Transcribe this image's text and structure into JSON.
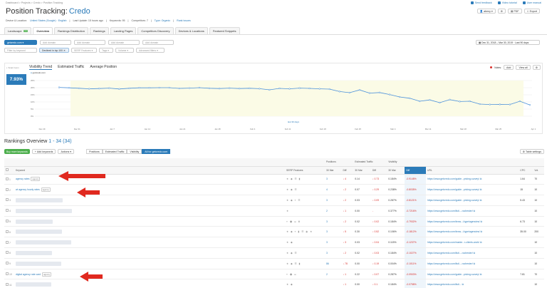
{
  "breadcrumb": [
    "Dashboard",
    "Projects",
    "Credo",
    "Position Tracking"
  ],
  "top_links": [
    "Send feedback",
    "Video tutorial",
    "User manual"
  ],
  "page": {
    "title": "Position Tracking:",
    "project": "Credo"
  },
  "header_actions": {
    "user": "abeny",
    "pdf": "PDF",
    "export": "Export"
  },
  "meta": {
    "device_label": "Device & Location:",
    "device_value": "United States (Google) · English",
    "last_update": "Last Update: 15 hours ago",
    "keywords": "Keywords: 95",
    "competitors": "Competitors: 7",
    "type": "Type: Organic",
    "rank_issues": "Rank issues"
  },
  "tabs": [
    {
      "label": "Landscape",
      "badge": "new"
    },
    {
      "label": "Overview",
      "active": true
    },
    {
      "label": "Rankings Distribution"
    },
    {
      "label": "Rankings"
    },
    {
      "label": "Landing Pages"
    },
    {
      "label": "Competitors Discovery"
    },
    {
      "label": "Devices & Locations"
    },
    {
      "label": "Featured Snippets"
    }
  ],
  "filters": {
    "domain": "getcredo.com",
    "add_domain": "Add domain",
    "search_placeholder": "Filter by keyword",
    "declined": "Declined in top 100",
    "serp": "SERP Features",
    "tags": "Tags",
    "volume": "Volume",
    "advanced": "Advanced filters",
    "date_range": "Dec 31, 2018 – Mar 30, 2019 · Last 90 days"
  },
  "chart_tabs": [
    "Visibility Trend",
    "Estimated Traffic",
    "Average Position"
  ],
  "chart": {
    "smart_zoom": "Smart zoom",
    "visibility_value": "7.93%",
    "legend_domain": "getcredo.com",
    "notes_label": "Notes:",
    "add_btn": "Add",
    "view_all": "View all",
    "last30": "last 30 days"
  },
  "chart_data": {
    "type": "line",
    "x_ticks": [
      "Dec 29",
      "Dec 31",
      "Jan 7",
      "Jan 14",
      "Jan 21",
      "Jan 28",
      "Feb 4",
      "Feb 11",
      "Feb 18",
      "Feb 25",
      "Mar 4",
      "Mar 11",
      "Mar 18",
      "Mar 25",
      "Apr 1"
    ],
    "y_ticks": [
      "25%",
      "20%",
      "15%",
      "10%",
      "5%",
      "0%"
    ],
    "ylim": [
      0,
      25
    ],
    "series": [
      {
        "name": "getcredo.com",
        "values": [
          20.2,
          19.9,
          19.6,
          19.2,
          19.4,
          19.7,
          19.1,
          19.6,
          19.9,
          19.9,
          20,
          20,
          19.5,
          19.7,
          20,
          19.6,
          19.4,
          19.7,
          19.4,
          19.6,
          19.3,
          18.5,
          19.5,
          19.2,
          19.7,
          19.5,
          19.2,
          19,
          17.3,
          16.5,
          18.4,
          16.2,
          16.6,
          15.2,
          13.5,
          12.6,
          10.5,
          11.4,
          9.5,
          11.6,
          10.3,
          10.5,
          8.5,
          8.2,
          8.3,
          8.2,
          10.5,
          7.9
        ],
        "x_start": "Dec 31"
      }
    ]
  },
  "rankings": {
    "title": "Rankings Overview",
    "range": "1 - 34 (34)",
    "buy_btn": "Buy more keywords",
    "add_keywords": "Add keywords",
    "actions": "Actions",
    "view_btns": [
      "Positions",
      "Estimated Traffic",
      "Visibility",
      "All for getcredo.com"
    ],
    "table_settings": "Table settings",
    "headers": {
      "keyword": "Keyword",
      "serp": "SERP Features",
      "positions": "Positions",
      "traffic": "Estimated Traffic",
      "visibility": "Visibility",
      "date": "30 Mar",
      "diff": "Diff",
      "url": "URL",
      "cpc": "CPC",
      "vol": "Vol."
    },
    "rows": [
      {
        "n": "1",
        "kw": "agency rates",
        "tag": "agency",
        "serp": "★ ◆ ☰ ▮",
        "pos": "3",
        "pdiff": "↓ 4",
        "tr": "0.14",
        "tdiff": "↓ 0.73",
        "vis": "0.184%",
        "vdiff": "-0.9148%",
        "url": "https://www.getcredo.com/guide...pricing-survey/",
        "cpc": "1.64",
        "vol": "70"
      },
      {
        "n": "2",
        "kw": "wi agency hourly rates",
        "tag": "agency",
        "serp": "★ ◆ ☰",
        "pos": "4",
        "pdiff": "↓ 2",
        "tr": "0.07",
        "tdiff": "↓ 0.29",
        "vis": "0.238%",
        "vdiff": "-0.8035%",
        "url": "https://www.getcredo.com/guide...pricing-survey/",
        "cpc": "15",
        "vol": "10"
      },
      {
        "n": "3",
        "kw": "",
        "tag": "",
        "serp": "★ ◆ ⌖ ☰",
        "pos": "3",
        "pdiff": "↓ 2",
        "tr": "0.03",
        "tdiff": "↓ 0.09",
        "vis": "0.287%",
        "vdiff": "-0.8121%",
        "url": "https://www.getcredo.com/guide...pricing-survey/",
        "cpc": "5.43",
        "vol": "10"
      },
      {
        "n": "4",
        "kw": "",
        "tag": "",
        "serp": "★",
        "pos": "2",
        "pdiff": "↓ 1",
        "tr": "0.00",
        "tdiff": "-",
        "vis": "0.377%",
        "vdiff": "-0.7216%",
        "url": "https://www.getcredo.com/listi...-rochester/",
        "cpc": "",
        "vol": "10"
      },
      {
        "n": "5",
        "kw": "",
        "tag": "",
        "serp": "⌖ ◆ ☰ ▮",
        "pos": "3",
        "pdiff": "↓ 2",
        "tr": "0.02",
        "tdiff": "↓ 0.02",
        "vis": "0.184%",
        "vdiff": "-0.7932%",
        "url": "https://www.getcredo.com/brow...l-type/agencies/",
        "cpc": "6.73",
        "vol": "10"
      },
      {
        "n": "6",
        "kw": "",
        "tag": "",
        "serp": "★ ◆ ⌖ ▮ ☰ ◉ ★",
        "pos": "3",
        "pdiff": "↓ 5",
        "tr": "0.30",
        "tdiff": "↓ 0.52",
        "vis": "0.106%",
        "vdiff": "-0.1812%",
        "url": "https://www.getcredo.com/brow...l-type/agencies/",
        "cpc": "35.00",
        "vol": "200"
      },
      {
        "n": "7",
        "kw": "",
        "tag": "",
        "serp": "★ ◆",
        "pos": "3",
        "pdiff": "↓ 3",
        "tr": "0.03",
        "tdiff": "↓ 0.04",
        "vis": "0.115%",
        "vdiff": "-0.1237%",
        "url": "https://www.getcredo.com/marke...r-clients-work/",
        "cpc": "",
        "vol": "10"
      },
      {
        "n": "8",
        "kw": "",
        "tag": "",
        "serp": "★ ◆ ☰",
        "pos": "3",
        "pdiff": "↓ 2",
        "tr": "0.02",
        "tdiff": "↓ 0.03",
        "vis": "0.184%",
        "vdiff": "-0.1027%",
        "url": "https://www.getcredo.com/listi...-rochester/",
        "cpc": "",
        "vol": "10"
      },
      {
        "n": "9",
        "kw": "",
        "tag": "",
        "serp": "★ ◆ ☰ ▮",
        "pos": "86",
        "pdiff": "↓ 78",
        "tr": "0.00",
        "tdiff": "↓ 0.19",
        "vis": "0.004%",
        "vdiff": "-0.1011%",
        "url": "https://www.getcredo.com/listi...-rochester/",
        "cpc": "",
        "vol": "10"
      },
      {
        "n": "10",
        "kw": "digital agency rate card",
        "tag": "agency",
        "serp": "⌖ ◆ ☰",
        "pos": "2",
        "pdiff": "↓ 1",
        "tr": "0.22",
        "tdiff": "↓ 0.07",
        "vis": "0.287%",
        "vdiff": "-0.0903%",
        "url": "https://www.getcredo.com/guide...pricing-survey/",
        "cpc": "7.81",
        "vol": "70"
      },
      {
        "n": "11",
        "kw": "",
        "tag": "",
        "serp": "★ ◆",
        "pos": "",
        "pdiff": "↓ 1",
        "tr": "0.00",
        "tdiff": "↓ 0.1",
        "vis": "0.184%",
        "vdiff": "-0.0758%",
        "url": "https://www.getcredo.com/listi...",
        "cpc": "",
        "vol": "10"
      }
    ]
  }
}
